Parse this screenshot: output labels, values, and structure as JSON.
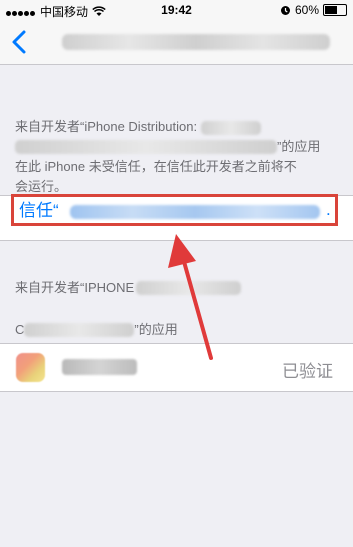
{
  "status_bar": {
    "carrier": "中国移动",
    "wifi_icon": "wifi-icon",
    "time": "19:42",
    "battery": "60%",
    "alarm_icon": "alarm-icon"
  },
  "nav": {
    "back_icon": "chevron-left-icon"
  },
  "section1": {
    "line1_prefix": "来自开发者“iPhone Distribution:",
    "line2_suffix": "”的应用",
    "line3": "在此 iPhone 未受信任，在信任此开发者之前将不",
    "line4": "会运行。"
  },
  "trust": {
    "label": "信任“",
    "dot": ".",
    "highlight_color": "#d9443a"
  },
  "section2": {
    "line1_prefix": "来自开发者“IPHONE",
    "line2_prefix": "C",
    "line2_suffix": "”的应用"
  },
  "app_row": {
    "status": "已验证"
  },
  "colors": {
    "accent": "#007aff",
    "annotation": "#e03a3a"
  }
}
